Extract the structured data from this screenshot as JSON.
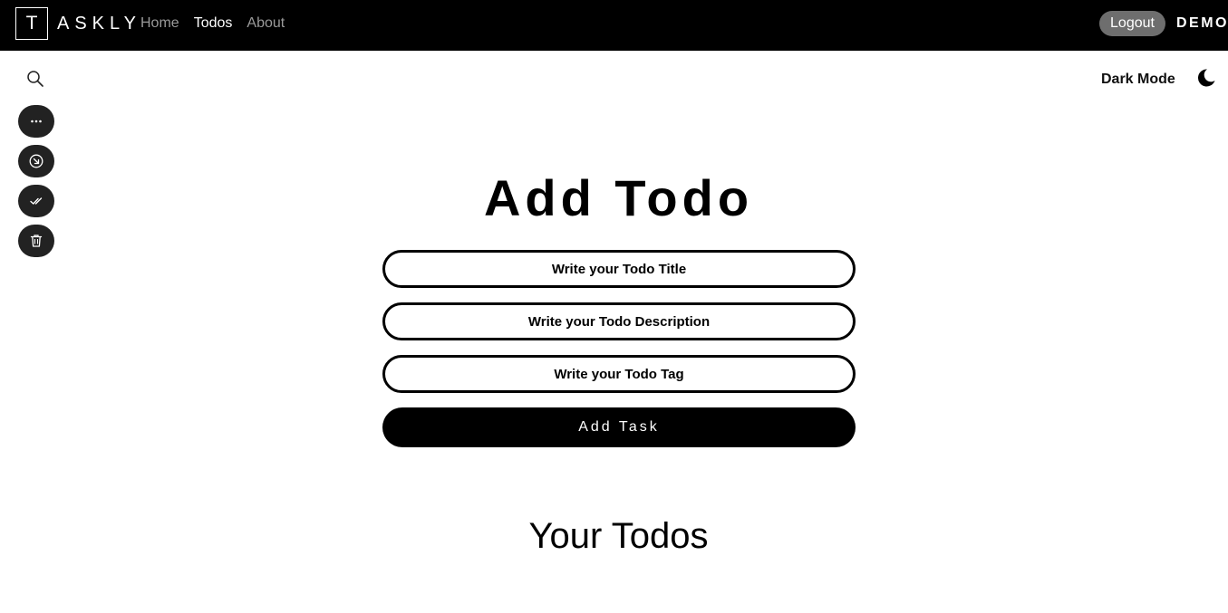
{
  "navbar": {
    "brand_initial": "T",
    "brand_rest": "ASKLY",
    "links": [
      {
        "label": "Home",
        "active": false
      },
      {
        "label": "Todos",
        "active": true
      },
      {
        "label": "About",
        "active": false
      }
    ],
    "logout_label": "Logout",
    "user_name": "DEMO"
  },
  "toolbar": {
    "search_icon": "search-icon",
    "tools": [
      {
        "icon": "more-horizontal-icon"
      },
      {
        "icon": "arrow-down-right-circle-icon"
      },
      {
        "icon": "double-check-icon"
      },
      {
        "icon": "trash-icon"
      }
    ]
  },
  "theme": {
    "dark_mode_label": "Dark Mode",
    "icon": "moon-icon"
  },
  "form": {
    "title": "Add Todo",
    "title_placeholder": "Write your Todo Title",
    "description_placeholder": "Write your Todo Description",
    "tag_placeholder": "Write your Todo Tag",
    "submit_label": "Add Task"
  },
  "todos": {
    "heading": "Your Todos"
  },
  "colors": {
    "navbar_bg": "#000000",
    "logout_bg": "#6e6e6e",
    "tool_button_bg": "#222222",
    "nav_inactive": "#9a9a9a"
  }
}
